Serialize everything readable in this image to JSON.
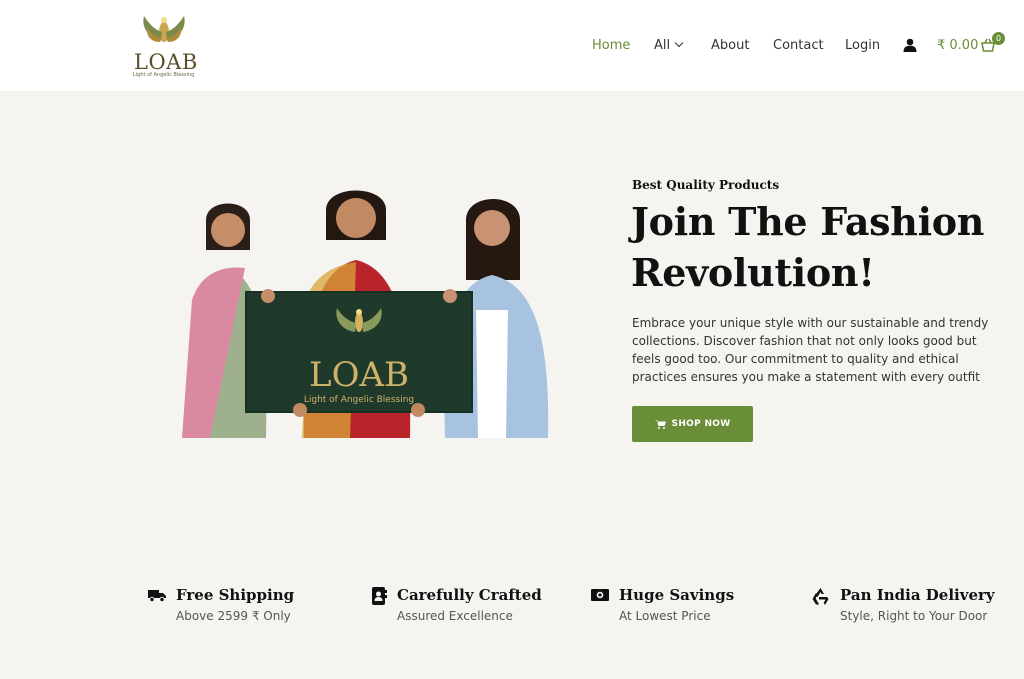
{
  "brand": {
    "name": "LOAB",
    "tagline": "Light of Angelic Blessing"
  },
  "nav": {
    "home": "Home",
    "all": "All",
    "about": "About",
    "contact": "Contact",
    "login": "Login"
  },
  "cart": {
    "amount": "₹ 0.00",
    "count": "0"
  },
  "hero": {
    "eyebrow": "Best Quality Products",
    "headline": "Join The Fashion Revolution!",
    "description": "Embrace your unique style with our sustainable and trendy collections. Discover fashion that not only looks good but feels good too. Our commitment to quality and ethical practices ensures you make a statement with every outfit",
    "button_label": "SHOP NOW",
    "sign_text": "LOAB",
    "sign_tagline": "Light of Angelic Blessing"
  },
  "features": [
    {
      "icon": "truck-icon",
      "title": "Free Shipping",
      "subtitle": "Above 2599 ₹ Only"
    },
    {
      "icon": "address-book-icon",
      "title": "Carefully Crafted",
      "subtitle": "Assured Excellence"
    },
    {
      "icon": "money-bill-icon",
      "title": "Huge Savings",
      "subtitle": "At Lowest Price"
    },
    {
      "icon": "recycle-icon",
      "title": "Pan India Delivery",
      "subtitle": "Style, Right to Your Door"
    }
  ],
  "colors": {
    "accent": "#6a8d37",
    "background": "#f5f4f0",
    "header": "#ffffff"
  }
}
